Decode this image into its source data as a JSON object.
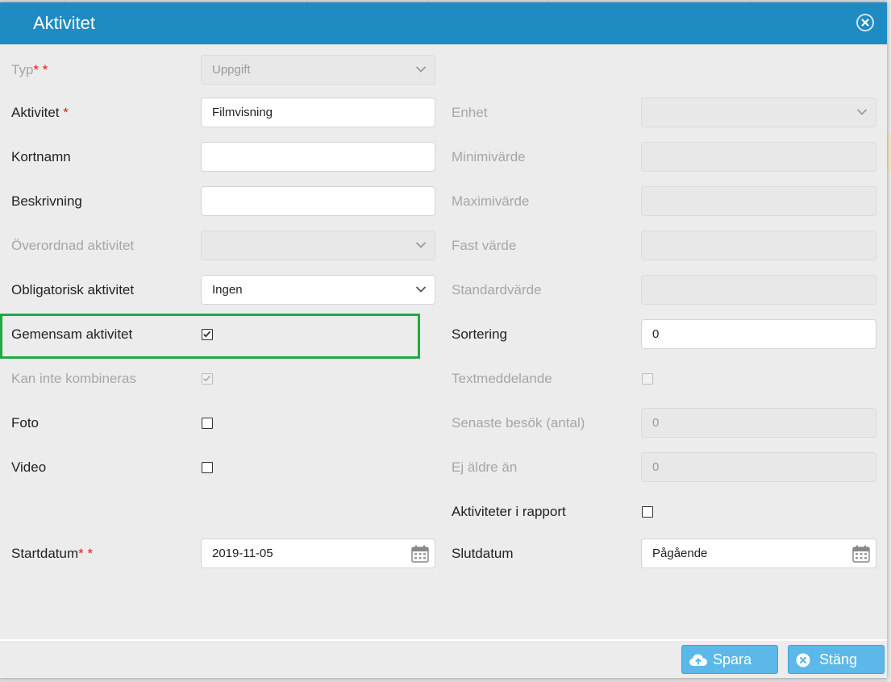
{
  "dialog": {
    "title": "Aktivitet",
    "close_icon": "close-circle-icon",
    "accent_color": "#1e8bc3",
    "highlight_color": "#22a845"
  },
  "left": {
    "typ": {
      "label": "Typ",
      "required_mark": "* *",
      "value": "Uppgift"
    },
    "aktivitet": {
      "label": "Aktivitet",
      "required_mark": "*",
      "value": "Filmvisning"
    },
    "kortnamn": {
      "label": "Kortnamn",
      "value": ""
    },
    "beskrivning": {
      "label": "Beskrivning",
      "value": ""
    },
    "overordnad": {
      "label": "Överordnad aktivitet",
      "value": ""
    },
    "obligatorisk": {
      "label": "Obligatorisk aktivitet",
      "value": "Ingen"
    },
    "gemensam": {
      "label": "Gemensam aktivitet",
      "checked": true
    },
    "kan_inte": {
      "label": "Kan inte kombineras",
      "checked": true
    },
    "foto": {
      "label": "Foto",
      "checked": false
    },
    "video": {
      "label": "Video",
      "checked": false
    },
    "startdatum": {
      "label": "Startdatum",
      "required_mark": "* *",
      "value": "2019-11-05"
    }
  },
  "right": {
    "enhet": {
      "label": "Enhet",
      "value": ""
    },
    "minimivarde": {
      "label": "Minimivärde",
      "value": ""
    },
    "maximivarde": {
      "label": "Maximivärde",
      "value": ""
    },
    "fast_varde": {
      "label": "Fast värde",
      "value": ""
    },
    "standardvarde": {
      "label": "Standardvärde",
      "value": ""
    },
    "sortering": {
      "label": "Sortering",
      "value": "0"
    },
    "textmeddelande": {
      "label": "Textmeddelande",
      "checked": false
    },
    "senaste_besok": {
      "label": "Senaste besök (antal)",
      "value": "0"
    },
    "ej_aldre_an": {
      "label": "Ej äldre än",
      "value": "0"
    },
    "aktiviteter_rapport": {
      "label": "Aktiviteter i rapport",
      "checked": false
    },
    "slutdatum": {
      "label": "Slutdatum",
      "value": "Pågående"
    }
  },
  "footer": {
    "save_label": "Spara",
    "save_icon": "cloud-upload-icon",
    "close_label": "Stäng",
    "close_icon": "close-circle-icon"
  }
}
